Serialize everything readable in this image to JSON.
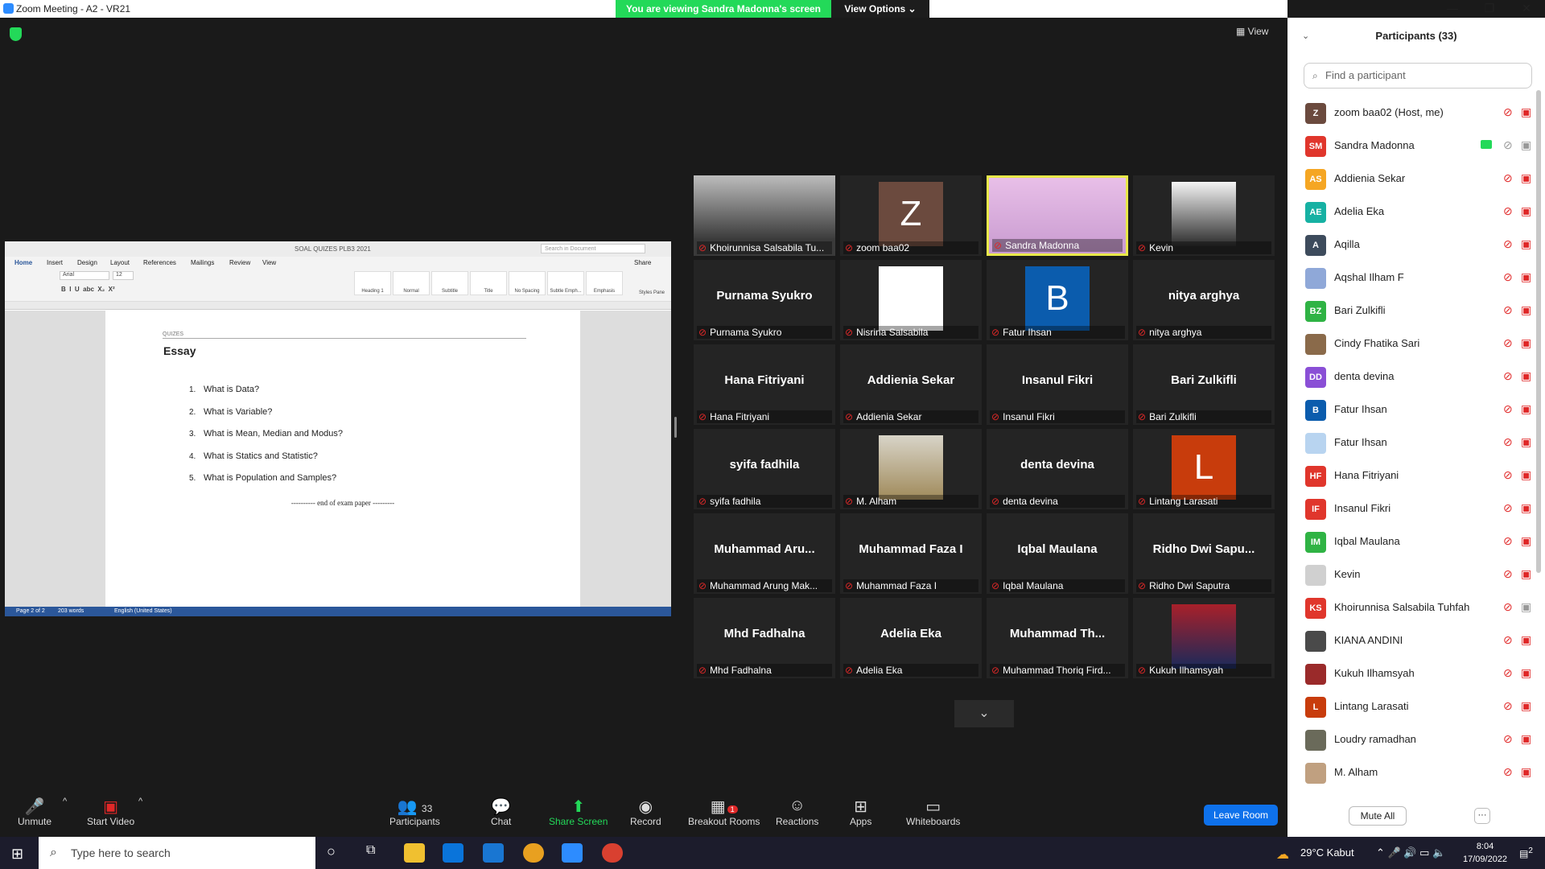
{
  "window": {
    "title": "Zoom Meeting - A2 - VR21"
  },
  "banner": {
    "text": "You are viewing Sandra Madonna's screen",
    "view_options": "View Options ⌄"
  },
  "view_label": "▦ View",
  "document": {
    "title": "SOAL QUIZES PLB3 2021",
    "search_placeholder": "Search in Document",
    "tabs": [
      "Home",
      "Insert",
      "Design",
      "Layout",
      "References",
      "Mailings",
      "Review",
      "View"
    ],
    "share": "Share",
    "font": "Arial",
    "size": "12",
    "styles": [
      "Heading 1",
      "Normal",
      "Subtitle",
      "Title",
      "No Spacing",
      "Subtle Emph...",
      "Emphasis"
    ],
    "styles_pane": "Styles Pane",
    "header": "QUIZES",
    "heading": "Essay",
    "questions": [
      {
        "n": "1.",
        "t": "What is Data?"
      },
      {
        "n": "2.",
        "t": "What is Variable?"
      },
      {
        "n": "3.",
        "t": "What is Mean, Median and Modus?"
      },
      {
        "n": "4.",
        "t": "What is Statics and Statistic?"
      },
      {
        "n": "5.",
        "t": "What is Population and Samples?"
      }
    ],
    "end": "---------- end of exam paper ---------",
    "status": {
      "page": "Page 2 of 2",
      "words": "203 words",
      "lang": "English (United States)"
    }
  },
  "gallery": [
    {
      "label": "Khoirunnisa Salsabila Tu...",
      "center": "",
      "kind": "video"
    },
    {
      "label": "zoom baa02",
      "center": "Z",
      "kind": "avatar",
      "color": "#6b4a3e"
    },
    {
      "label": "Sandra Madonna",
      "center": "",
      "kind": "video-active"
    },
    {
      "label": "Kevin",
      "center": "",
      "kind": "photo"
    },
    {
      "label": "Purnama Syukro",
      "center": "Purnama Syukro",
      "kind": "name"
    },
    {
      "label": "Nisrina Salsabila",
      "center": "",
      "kind": "white"
    },
    {
      "label": "Fatur Ihsan",
      "center": "B",
      "kind": "avatar",
      "color": "#0b5cad"
    },
    {
      "label": "nitya arghya",
      "center": "nitya arghya",
      "kind": "name"
    },
    {
      "label": "Hana Fitriyani",
      "center": "Hana Fitriyani",
      "kind": "name"
    },
    {
      "label": "Addienia Sekar",
      "center": "Addienia Sekar",
      "kind": "name"
    },
    {
      "label": "Insanul Fikri",
      "center": "Insanul Fikri",
      "kind": "name"
    },
    {
      "label": "Bari Zulkifli",
      "center": "Bari Zulkifli",
      "kind": "name"
    },
    {
      "label": "syifa fadhila",
      "center": "syifa fadhila",
      "kind": "name"
    },
    {
      "label": "M. Alham",
      "center": "",
      "kind": "photo2"
    },
    {
      "label": "denta devina",
      "center": "denta devina",
      "kind": "name"
    },
    {
      "label": "Lintang Larasati",
      "center": "L",
      "kind": "avatar",
      "color": "#c83c0c"
    },
    {
      "label": "Muhammad Arung Mak...",
      "center": "Muhammad Aru...",
      "kind": "name"
    },
    {
      "label": "Muhammad Faza I",
      "center": "Muhammad Faza I",
      "kind": "name"
    },
    {
      "label": "Iqbal Maulana",
      "center": "Iqbal Maulana",
      "kind": "name"
    },
    {
      "label": "Ridho Dwi Saputra",
      "center": "Ridho Dwi Sapu...",
      "kind": "name"
    },
    {
      "label": "Mhd Fadhalna",
      "center": "Mhd Fadhalna",
      "kind": "name"
    },
    {
      "label": "Adelia Eka",
      "center": "Adelia Eka",
      "kind": "name"
    },
    {
      "label": "Muhammad Thoriq Fird...",
      "center": "Muhammad Th...",
      "kind": "name"
    },
    {
      "label": "Kukuh Ilhamsyah",
      "center": "",
      "kind": "photo3"
    }
  ],
  "panel": {
    "title": "Participants (33)",
    "search_placeholder": "Find a participant",
    "mute_all": "Mute All",
    "more": "···",
    "participants": [
      {
        "initials": "Z",
        "name": "zoom baa02 (Host, me)",
        "color": "#6b4a3e"
      },
      {
        "initials": "SM",
        "name": "Sandra Madonna",
        "color": "#e0362c",
        "sharing": true
      },
      {
        "initials": "AS",
        "name": "Addienia Sekar",
        "color": "#f5a623"
      },
      {
        "initials": "AE",
        "name": "Adelia Eka",
        "color": "#16b1a3"
      },
      {
        "initials": "A",
        "name": "Aqilla",
        "color": "#3d4b5c"
      },
      {
        "initials": "",
        "name": "Aqshal Ilham F",
        "color": "#8fa8d8"
      },
      {
        "initials": "BZ",
        "name": "Bari Zulkifli",
        "color": "#2fb344"
      },
      {
        "initials": "",
        "name": "Cindy Fhatika Sari",
        "color": "#8a6a4a"
      },
      {
        "initials": "DD",
        "name": "denta devina",
        "color": "#8a4fd6"
      },
      {
        "initials": "B",
        "name": "Fatur Ihsan",
        "color": "#0b5cad"
      },
      {
        "initials": "",
        "name": "Fatur Ihsan",
        "color": "#b8d4f0"
      },
      {
        "initials": "HF",
        "name": "Hana Fitriyani",
        "color": "#e0362c"
      },
      {
        "initials": "IF",
        "name": "Insanul Fikri",
        "color": "#e0362c"
      },
      {
        "initials": "IM",
        "name": "Iqbal Maulana",
        "color": "#2fb344"
      },
      {
        "initials": "",
        "name": "Kevin",
        "color": "#d0d0d0"
      },
      {
        "initials": "KS",
        "name": "Khoirunnisa Salsabila Tuhfah",
        "color": "#e0362c"
      },
      {
        "initials": "",
        "name": "KIANA ANDINI",
        "color": "#4a4a4a"
      },
      {
        "initials": "",
        "name": "Kukuh Ilhamsyah",
        "color": "#9a2a2a"
      },
      {
        "initials": "L",
        "name": "Lintang Larasati",
        "color": "#c83c0c"
      },
      {
        "initials": "",
        "name": "Loudry ramadhan",
        "color": "#6a6a5a"
      },
      {
        "initials": "",
        "name": "M. Alham",
        "color": "#c0a080"
      }
    ]
  },
  "toolbar": {
    "unmute": "Unmute",
    "start_video": "Start Video",
    "participants": "Participants",
    "participants_count": "33",
    "chat": "Chat",
    "share_screen": "Share Screen",
    "record": "Record",
    "breakout": "Breakout Rooms",
    "breakout_badge": "1",
    "reactions": "Reactions",
    "apps": "Apps",
    "whiteboards": "Whiteboards",
    "leave": "Leave Room"
  },
  "taskbar": {
    "search_placeholder": "Type here to search",
    "weather": "29°C  Kabut",
    "time": "8:04",
    "date": "17/09/2022",
    "notif": "2"
  }
}
